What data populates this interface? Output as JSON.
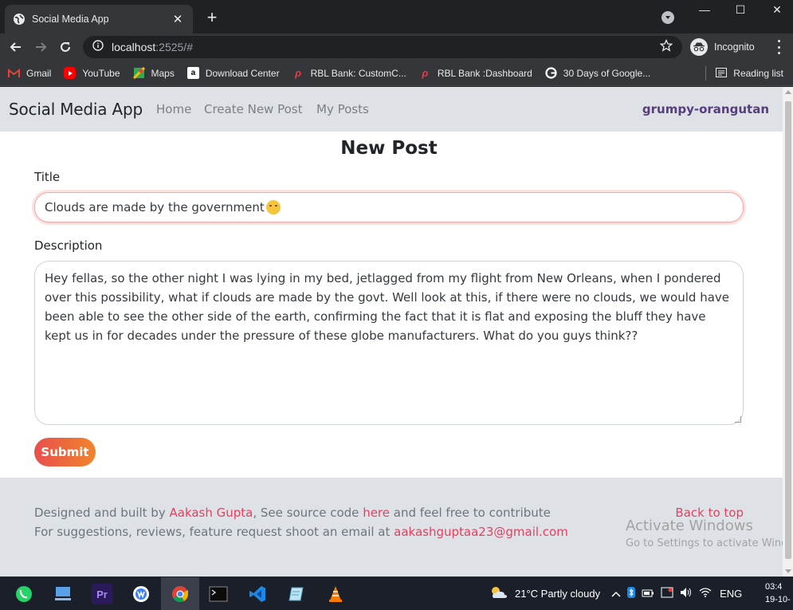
{
  "browser": {
    "tab_title": "Social Media App",
    "url_host": "localhost",
    "url_path": ":2525/#",
    "incognito_label": "Incognito",
    "bookmarks": [
      {
        "label": "Gmail",
        "icon": "gmail-icon",
        "color": "#ea4335"
      },
      {
        "label": "YouTube",
        "icon": "youtube-icon",
        "color": "#ff0000"
      },
      {
        "label": "Maps",
        "icon": "maps-icon",
        "color": "#34a853"
      },
      {
        "label": "Download Center",
        "icon": "amazon-icon",
        "color": "#ffffff"
      },
      {
        "label": "RBL Bank: CustomC...",
        "icon": "rbl-icon",
        "color": "#1c4f9c"
      },
      {
        "label": "RBL Bank :Dashboard",
        "icon": "rbl-icon",
        "color": "#1c4f9c"
      },
      {
        "label": "30 Days of Google...",
        "icon": "google-icon",
        "color": "#4285f4"
      }
    ],
    "reading_list": "Reading list"
  },
  "navbar": {
    "brand": "Social Media App",
    "links": [
      "Home",
      "Create New Post",
      "My Posts"
    ],
    "username": "grumpy-orangutan"
  },
  "form": {
    "heading": "New Post",
    "title_label": "Title",
    "title_value": "Clouds are made by the government",
    "description_label": "Description",
    "description_value": "Hey fellas, so the other night I was lying in my bed, jetlagged from my flight from New Orleans, when I pondered over this possibility, what if clouds are made by the govt. Well look at this, if there were no clouds, we would have been able to see the other side of the earth, confirming the fact that it is flat and exposing the bluff they have kept us in for decades under the pressure of these globe manufacturers. What do you guys think??",
    "submit_label": "Submit",
    "accent_color": "#e94e4e"
  },
  "footer": {
    "line1_prefix": "Designed and built by ",
    "author": "Aakash Gupta",
    "line1_mid": ", See source code ",
    "here": "here",
    "line1_suffix": " and feel free to contribute",
    "line2_prefix": "For suggestions, reviews, feature request shoot an email at ",
    "email": "aakashguptaa23@gmail.com",
    "back_to_top": "Back to top"
  },
  "watermark": {
    "title": "Activate Windows",
    "subtitle": "Go to Settings to activate Windows."
  },
  "taskbar": {
    "weather": "21°C  Partly cloudy",
    "language": "ENG",
    "time": "03:4",
    "date": "19-10-"
  }
}
